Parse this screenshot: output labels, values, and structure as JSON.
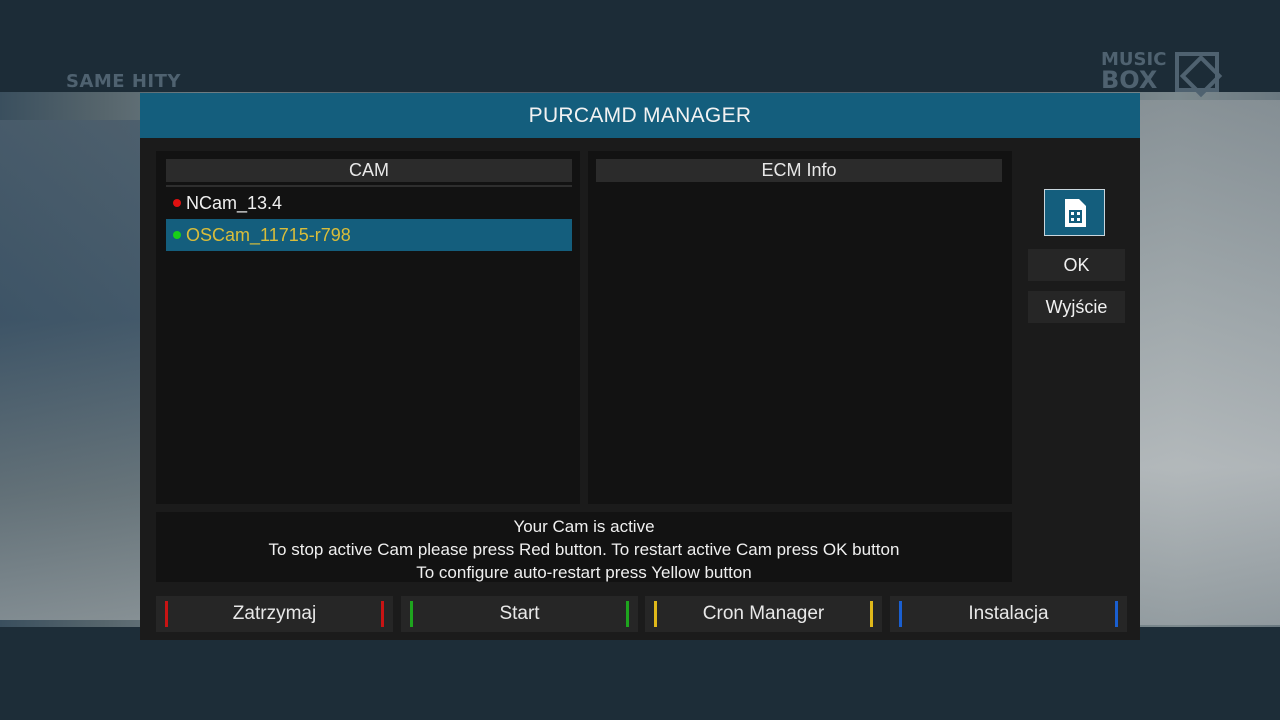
{
  "background": {
    "channel_logo_left": "SAME HITY",
    "channel_logo_right_line1": "MUSIC",
    "channel_logo_right_line2": "BOX"
  },
  "dialog": {
    "title": "PURCAMD MANAGER",
    "cam_panel": {
      "header": "CAM",
      "items": [
        {
          "label": "NCam_13.4",
          "status_color": "#e01010",
          "selected": false
        },
        {
          "label": "OSCam_11715-r798",
          "status_color": "#18d018",
          "selected": true
        }
      ]
    },
    "ecm_panel": {
      "header": "ECM Info"
    },
    "side_buttons": {
      "sim_icon": "sim-card-icon",
      "ok": "OK",
      "exit": "Wyjście"
    },
    "status": {
      "line1": "Your Cam is active",
      "line2": "To stop active Cam please press Red button. To restart active Cam press OK button",
      "line3": "To configure auto-restart press Yellow button"
    },
    "function_keys": [
      {
        "label": "Zatrzymaj",
        "color": "#c81414"
      },
      {
        "label": "Start",
        "color": "#1ea41e"
      },
      {
        "label": "Cron Manager",
        "color": "#e0b81a"
      },
      {
        "label": "Instalacja",
        "color": "#1a5fd0"
      }
    ]
  },
  "colors": {
    "accent": "#145e7d",
    "selected_text": "#d9bd3a",
    "panel_bg": "#121212",
    "dialog_bg": "#1b1b1b"
  }
}
